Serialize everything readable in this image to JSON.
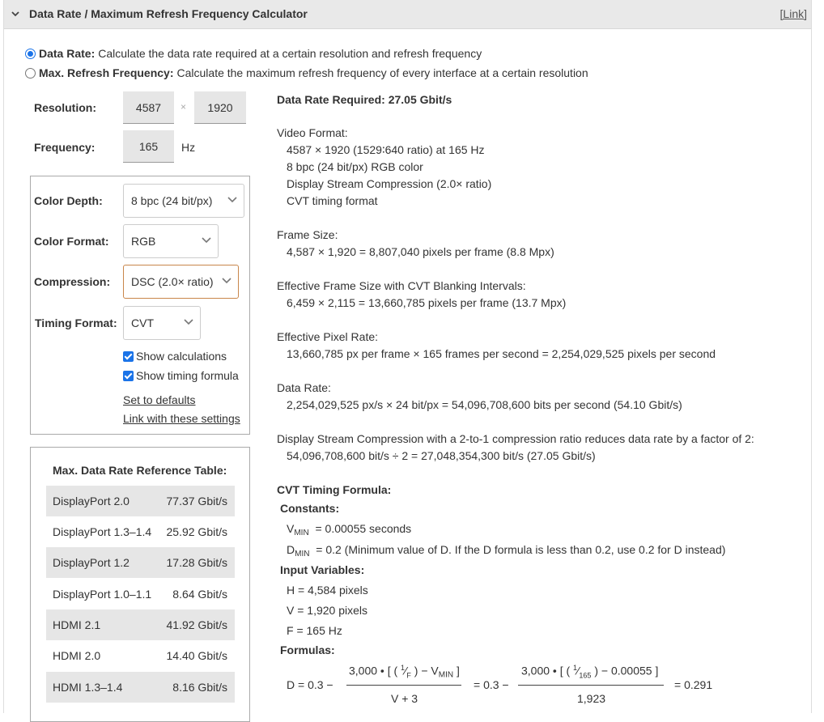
{
  "header": {
    "title": "Data Rate / Maximum Refresh Frequency Calculator",
    "link": "[Link]"
  },
  "modes": [
    {
      "bold": "Data Rate:",
      "desc": "Calculate the data rate required at a certain resolution and refresh frequency",
      "checked": true
    },
    {
      "bold": "Max. Refresh Frequency:",
      "desc": "Calculate the maximum refresh frequency of every interface at a certain resolution",
      "checked": false
    }
  ],
  "inputs": {
    "resolution_label": "Resolution:",
    "width": "4587",
    "times": "×",
    "height": "1920",
    "frequency_label": "Frequency:",
    "frequency": "165",
    "frequency_unit": "Hz"
  },
  "options": {
    "color_depth_label": "Color Depth:",
    "color_depth": "8 bpc (24 bit/px)",
    "color_format_label": "Color Format:",
    "color_format": "RGB",
    "compression_label": "Compression:",
    "compression": "DSC (2.0× ratio)",
    "timing_label": "Timing Format:",
    "timing": "CVT",
    "show_calculations": "Show calculations",
    "show_timing_formula": "Show timing formula",
    "set_defaults": "Set to defaults",
    "link_settings": "Link with these settings"
  },
  "reference": {
    "title": "Max. Data Rate Reference Table:",
    "rows": [
      {
        "name": "DisplayPort 2.0",
        "value": "77.37 Gbit/s"
      },
      {
        "name": "DisplayPort 1.3–1.4",
        "value": "25.92 Gbit/s"
      },
      {
        "name": "DisplayPort 1.2",
        "value": "17.28 Gbit/s"
      },
      {
        "name": "DisplayPort 1.0–1.1",
        "value": "8.64 Gbit/s"
      },
      {
        "name": "HDMI 2.1",
        "value": "41.92 Gbit/s"
      },
      {
        "name": "HDMI 2.0",
        "value": "14.40 Gbit/s"
      },
      {
        "name": "HDMI 1.3–1.4",
        "value": "8.16 Gbit/s"
      }
    ]
  },
  "results": {
    "required": "Data Rate Required: 27.05 Gbit/s",
    "video_format_label": "Video Format:",
    "video_format": [
      "4587 × 1920 (1529∶640 ratio) at 165 Hz",
      "8 bpc (24 bit/px) RGB color",
      "Display Stream Compression (2.0× ratio)",
      "CVT timing format"
    ],
    "frame_size_label": "Frame Size:",
    "frame_size": "4,587 × 1,920 = 8,807,040 pixels per frame (8.8 Mpx)",
    "effective_frame_label": "Effective Frame Size with CVT Blanking Intervals:",
    "effective_frame": "6,459 × 2,115 = 13,660,785 pixels per frame (13.7 Mpx)",
    "pixel_rate_label": "Effective Pixel Rate:",
    "pixel_rate": "13,660,785 px per frame × 165 frames per second = 2,254,029,525 pixels per second",
    "data_rate_label": "Data Rate:",
    "data_rate": "2,254,029,525 px/s × 24 bit/px = 54,096,708,600 bits per second (54.10 Gbit/s)",
    "dsc_label": "Display Stream Compression with a 2-to-1 compression ratio reduces data rate by a factor of 2:",
    "dsc": "54,096,708,600 bit/s ÷ 2 = 27,048,354,300 bit/s (27.05 Gbit/s)"
  },
  "formula": {
    "title": "CVT Timing Formula:",
    "constants_label": "Constants:",
    "vmin_sym": "V",
    "vmin_sub": "MIN",
    "vmin_eq": "=  0.00055 seconds",
    "dmin_sym": "D",
    "dmin_sub": "MIN",
    "dmin_eq": "=  0.2 (Minimum value of D. If the D formula is less than 0.2, use 0.2 for D instead)",
    "input_label": "Input Variables:",
    "h": "H  =  4,584 pixels",
    "v": "V  =  1,920 pixels",
    "f": "F  =  165 Hz",
    "formulas_label": "Formulas:",
    "d_lhs": "D  =  0.3 −",
    "d_num1_a": "3,000 • [ ( ",
    "d_num1_b": "1",
    "d_num1_c": "⁄",
    "d_num1_d": "F",
    "d_num1_e": " ) − V",
    "d_num1_sub": "MIN",
    "d_num1_f": " ]",
    "d_den1": "V + 3",
    "d_mid": "=  0.3 −",
    "d_num2_a": "3,000 • [ ( ",
    "d_num2_b": "1",
    "d_num2_c": "⁄",
    "d_num2_d": "165",
    "d_num2_e": " ) − 0.00055 ]",
    "d_den2": "1,923",
    "d_result": "=  0.291"
  }
}
